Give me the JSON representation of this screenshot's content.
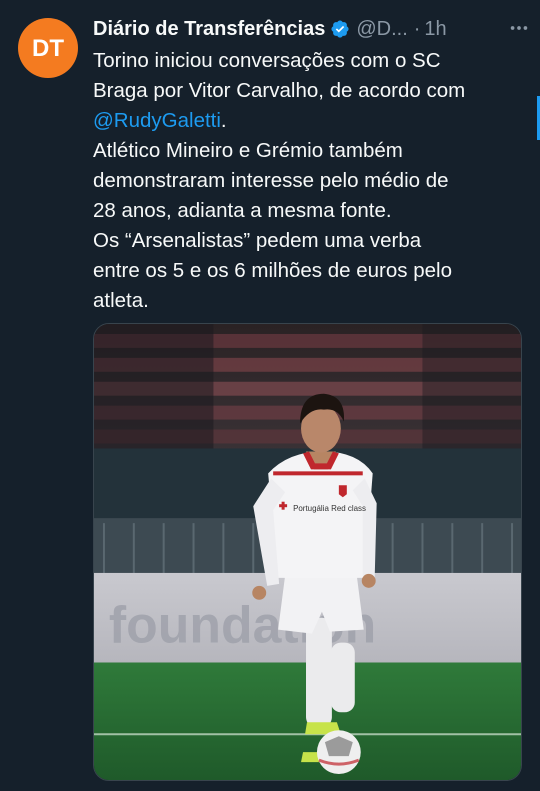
{
  "tweet": {
    "display_name": "Diário de Transferências",
    "handle": "@D...",
    "separator": "·",
    "time": "1h",
    "avatar_text": "DT",
    "verified_icon": "verified-badge-icon",
    "more_icon": "more-options-icon",
    "lines": [
      "Torino iniciou conversações com o SC",
      "Braga por Vitor Carvalho, de acordo com"
    ],
    "mention": "@RudyGaletti",
    "mention_suffix": ".",
    "lines_after": [
      "Atlético Mineiro e Grémio também",
      "demonstraram interesse pelo médio de",
      "28 anos, adianta a mesma fonte.",
      "Os “Arsenalistas” pedem uma verba",
      "entre os 5 e os 6 milhões de euros pelo",
      "atleta."
    ],
    "media": {
      "board_text": "foundation",
      "shirt_text": "Portugália Red class"
    }
  },
  "colors": {
    "background": "#15202b",
    "text": "#f7f9f9",
    "muted": "#8b98a5",
    "link": "#1d9bf0",
    "avatar": "#f47b20"
  }
}
